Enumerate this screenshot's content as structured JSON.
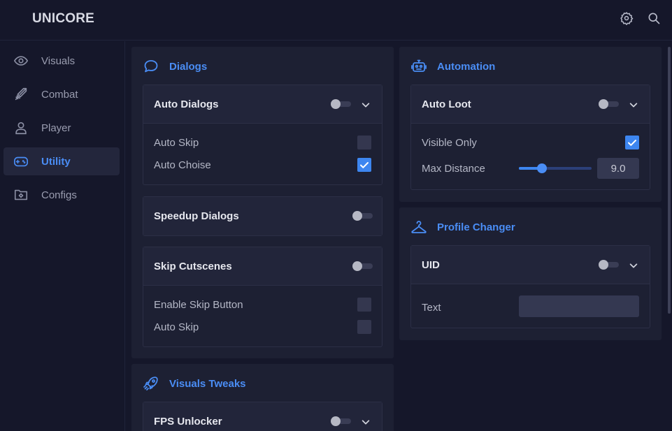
{
  "app": {
    "title": "UNICORE"
  },
  "topbar": {
    "settings_icon": "gear-icon",
    "search_icon": "search-icon"
  },
  "sidebar": {
    "items": [
      {
        "label": "Visuals",
        "icon": "eye-icon",
        "active": false
      },
      {
        "label": "Combat",
        "icon": "sword-icon",
        "active": false
      },
      {
        "label": "Player",
        "icon": "user-icon",
        "active": false
      },
      {
        "label": "Utility",
        "icon": "gamepad-icon",
        "active": true
      },
      {
        "label": "Configs",
        "icon": "folder-gear-icon",
        "active": false
      }
    ]
  },
  "colors": {
    "accent": "#4a8df5",
    "background": "#15172a",
    "panel": "#1d2033"
  },
  "dialogs": {
    "title": "Dialogs",
    "auto_dialogs": {
      "title": "Auto Dialogs",
      "enabled": false,
      "options": [
        {
          "label": "Auto Skip",
          "checked": false
        },
        {
          "label": "Auto Choise",
          "checked": true
        }
      ]
    },
    "speedup_dialogs": {
      "title": "Speedup Dialogs",
      "enabled": false
    },
    "skip_cutscenes": {
      "title": "Skip Cutscenes",
      "enabled": false,
      "options": [
        {
          "label": "Enable Skip Button",
          "checked": false
        },
        {
          "label": "Auto Skip",
          "checked": false
        }
      ]
    }
  },
  "visuals_tweaks": {
    "title": "Visuals Tweaks",
    "fps_unlocker": {
      "title": "FPS Unlocker",
      "enabled": false
    }
  },
  "automation": {
    "title": "Automation",
    "auto_loot": {
      "title": "Auto Loot",
      "enabled": false,
      "visible_only": {
        "label": "Visible Only",
        "checked": true
      },
      "max_distance": {
        "label": "Max Distance",
        "value": "9.0",
        "fraction": 0.32
      }
    }
  },
  "profile_changer": {
    "title": "Profile Changer",
    "uid": {
      "title": "UID",
      "enabled": false,
      "text_label": "Text",
      "text_value": ""
    }
  }
}
